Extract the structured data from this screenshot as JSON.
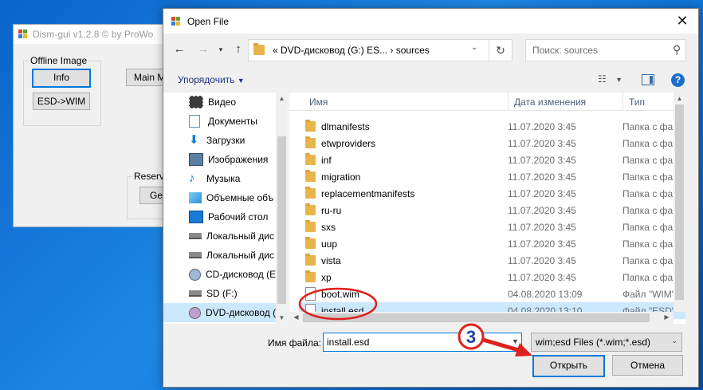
{
  "background_window": {
    "title": "Dism-gui v1.2.8   © by ProWo",
    "group_label": "Offline Image",
    "info_button": "Info",
    "esd_wim_button": "ESD->WIM",
    "main_button": "Main Me",
    "reserve_label": "Reserve",
    "get_button": "Get"
  },
  "dialog": {
    "title": "Open File",
    "address_path": "«  DVD-дисковод (G:) ES...  ›  sources",
    "search_placeholder": "Поиск: sources",
    "organize_label": "Упорядочить",
    "sidebar_items": [
      {
        "label": "Видео",
        "icon": "video-icon"
      },
      {
        "label": "Документы",
        "icon": "documents-icon"
      },
      {
        "label": "Загрузки",
        "icon": "downloads-icon"
      },
      {
        "label": "Изображения",
        "icon": "pictures-icon"
      },
      {
        "label": "Музыка",
        "icon": "music-icon"
      },
      {
        "label": "Объемные объ",
        "icon": "3d-objects-icon"
      },
      {
        "label": "Рабочий стол",
        "icon": "desktop-icon"
      },
      {
        "label": "Локальный дис",
        "icon": "drive-icon"
      },
      {
        "label": "Локальный дис",
        "icon": "drive-icon"
      },
      {
        "label": "CD-дисковод (E",
        "icon": "cd-drive-icon"
      },
      {
        "label": "SD (F:)",
        "icon": "drive-icon"
      },
      {
        "label": "DVD-дисковод (",
        "icon": "dvd-drive-icon",
        "selected": true
      }
    ],
    "columns": {
      "name": "Имя",
      "date": "Дата изменения",
      "type": "Тип"
    },
    "files": [
      {
        "name": "dlmanifests",
        "date": "11.07.2020 3:45",
        "type": "Папка с фай",
        "kind": "folder"
      },
      {
        "name": "etwproviders",
        "date": "11.07.2020 3:45",
        "type": "Папка с фай",
        "kind": "folder"
      },
      {
        "name": "inf",
        "date": "11.07.2020 3:45",
        "type": "Папка с фай",
        "kind": "folder"
      },
      {
        "name": "migration",
        "date": "11.07.2020 3:45",
        "type": "Папка с фай",
        "kind": "folder"
      },
      {
        "name": "replacementmanifests",
        "date": "11.07.2020 3:45",
        "type": "Папка с фай",
        "kind": "folder"
      },
      {
        "name": "ru-ru",
        "date": "11.07.2020 3:45",
        "type": "Папка с фай",
        "kind": "folder"
      },
      {
        "name": "sxs",
        "date": "11.07.2020 3:45",
        "type": "Папка с фай",
        "kind": "folder"
      },
      {
        "name": "uup",
        "date": "11.07.2020 3:45",
        "type": "Папка с фай",
        "kind": "folder"
      },
      {
        "name": "vista",
        "date": "11.07.2020 3:45",
        "type": "Папка с фай",
        "kind": "folder"
      },
      {
        "name": "xp",
        "date": "11.07.2020 3:45",
        "type": "Папка с фай",
        "kind": "folder"
      },
      {
        "name": "boot.wim",
        "date": "04.08.2020 13:09",
        "type": "Файл \"WIM\"",
        "kind": "file"
      },
      {
        "name": "install.esd",
        "date": "04.08.2020 13:10",
        "type": "Файл \"ESD\"",
        "kind": "file",
        "selected": true
      }
    ],
    "filename_label": "Имя файла:",
    "filename_value": "install.esd",
    "filter_value": "wim;esd Files (*.wim;*.esd)",
    "open_button": "Открыть",
    "cancel_button": "Отмена"
  },
  "annotation": {
    "step_number": "3",
    "color": "#e0201c"
  }
}
